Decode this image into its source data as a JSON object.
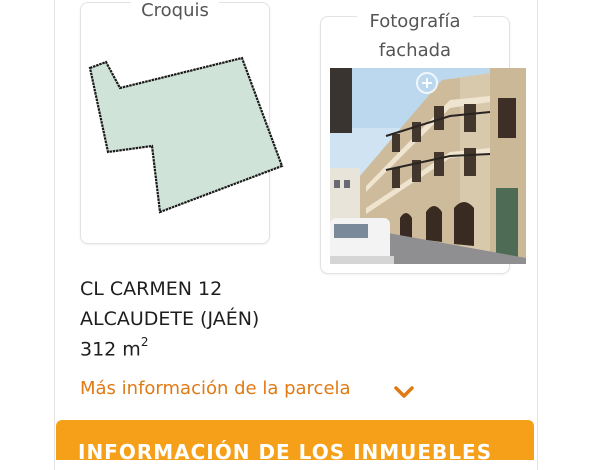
{
  "croquis": {
    "title": "Croquis"
  },
  "fachada": {
    "title_line1": "Fotografía",
    "title_line2": "fachada"
  },
  "parcela": {
    "address_line1": "CL CARMEN 12",
    "address_line2": "ALCAUDETE (JAÉN)",
    "area_value": "312 m",
    "area_sup": "2",
    "more_info_label": "Más información de la parcela"
  },
  "section_bar": {
    "label": "INFORMACIÓN DE LOS INMUEBLES"
  },
  "colors": {
    "accent": "#e07a14",
    "bar": "#f6a01a",
    "parcel_fill": "#cfe3d8"
  },
  "icons": {
    "more_info": "chevron-down-icon",
    "photo_zoom": "zoom-plus-icon"
  }
}
